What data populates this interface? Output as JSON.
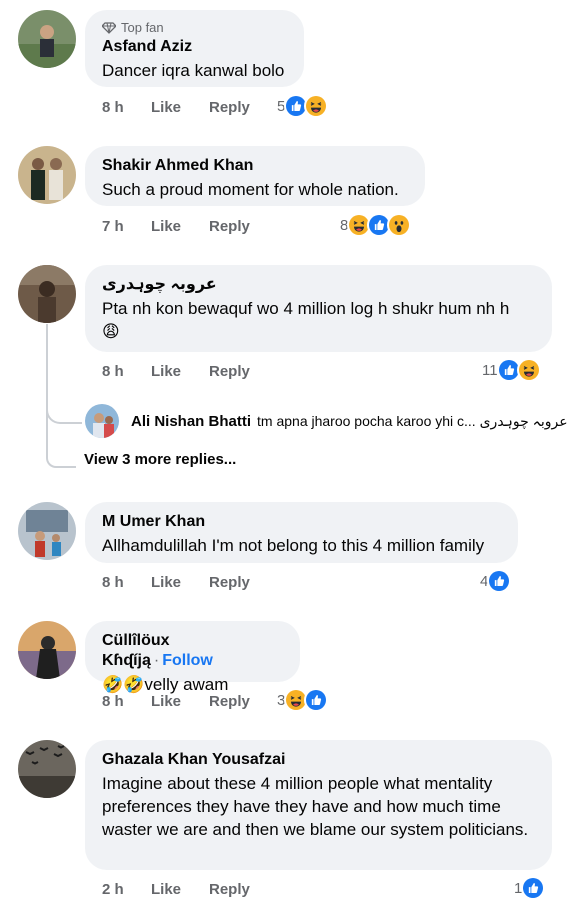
{
  "comments": [
    {
      "name": "Asfand Aziz",
      "badge": "Top fan",
      "text": "Dancer iqra kanwal bolo",
      "time": "8 h",
      "like": "Like",
      "reply": "Reply",
      "reactions": {
        "count": "5",
        "icons": [
          "like-icon",
          "haha-icon"
        ]
      }
    },
    {
      "name": "Shakir Ahmed Khan",
      "text": "Such a proud moment for whole nation.",
      "time": "7 h",
      "like": "Like",
      "reply": "Reply",
      "reactions": {
        "count": "8",
        "icons": [
          "haha-icon",
          "like-icon",
          "wow-icon"
        ]
      }
    },
    {
      "name": "عروبہ چوہدری",
      "text": "Pta nh kon bewaquf wo 4 million log h shukr hum nh h",
      "emoji": "😩",
      "time": "8 h",
      "like": "Like",
      "reply": "Reply",
      "reactions": {
        "count": "11",
        "icons": [
          "like-icon",
          "haha-icon"
        ]
      },
      "reply_preview": {
        "name": "Ali Nishan Bhatti",
        "text": "tm apna jharoo pocha karoo yhi c... عروبہ چوہدری"
      },
      "view_more": "View 3 more replies..."
    },
    {
      "name": "M Umer Khan",
      "text": "Allhamdulillah I'm not belong to this 4 million family",
      "time": "8 h",
      "like": "Like",
      "reply": "Reply",
      "reactions": {
        "count": "4",
        "icons": [
          "like-icon"
        ]
      }
    },
    {
      "name": "Cüllîlöux Kɦᶑíją",
      "follow": "Follow",
      "text": "🤣🤣velly awam",
      "time": "8 h",
      "like": "Like",
      "reply": "Reply",
      "reactions": {
        "count": "3",
        "icons": [
          "haha-icon",
          "like-icon"
        ]
      }
    },
    {
      "name": "Ghazala Khan Yousafzai",
      "text": "Imagine about these 4 million people what mentality preferences they have they have and how much time waster we are and then we blame our system politicians.",
      "time": "2 h",
      "like": "Like",
      "reply": "Reply",
      "reactions": {
        "count": "1",
        "icons": [
          "like-icon"
        ]
      }
    }
  ],
  "colors": {
    "link": "#1877f2",
    "like": "#1877f2",
    "haha": "#f7b125",
    "bubble": "#f0f2f5",
    "meta": "#65676b"
  }
}
